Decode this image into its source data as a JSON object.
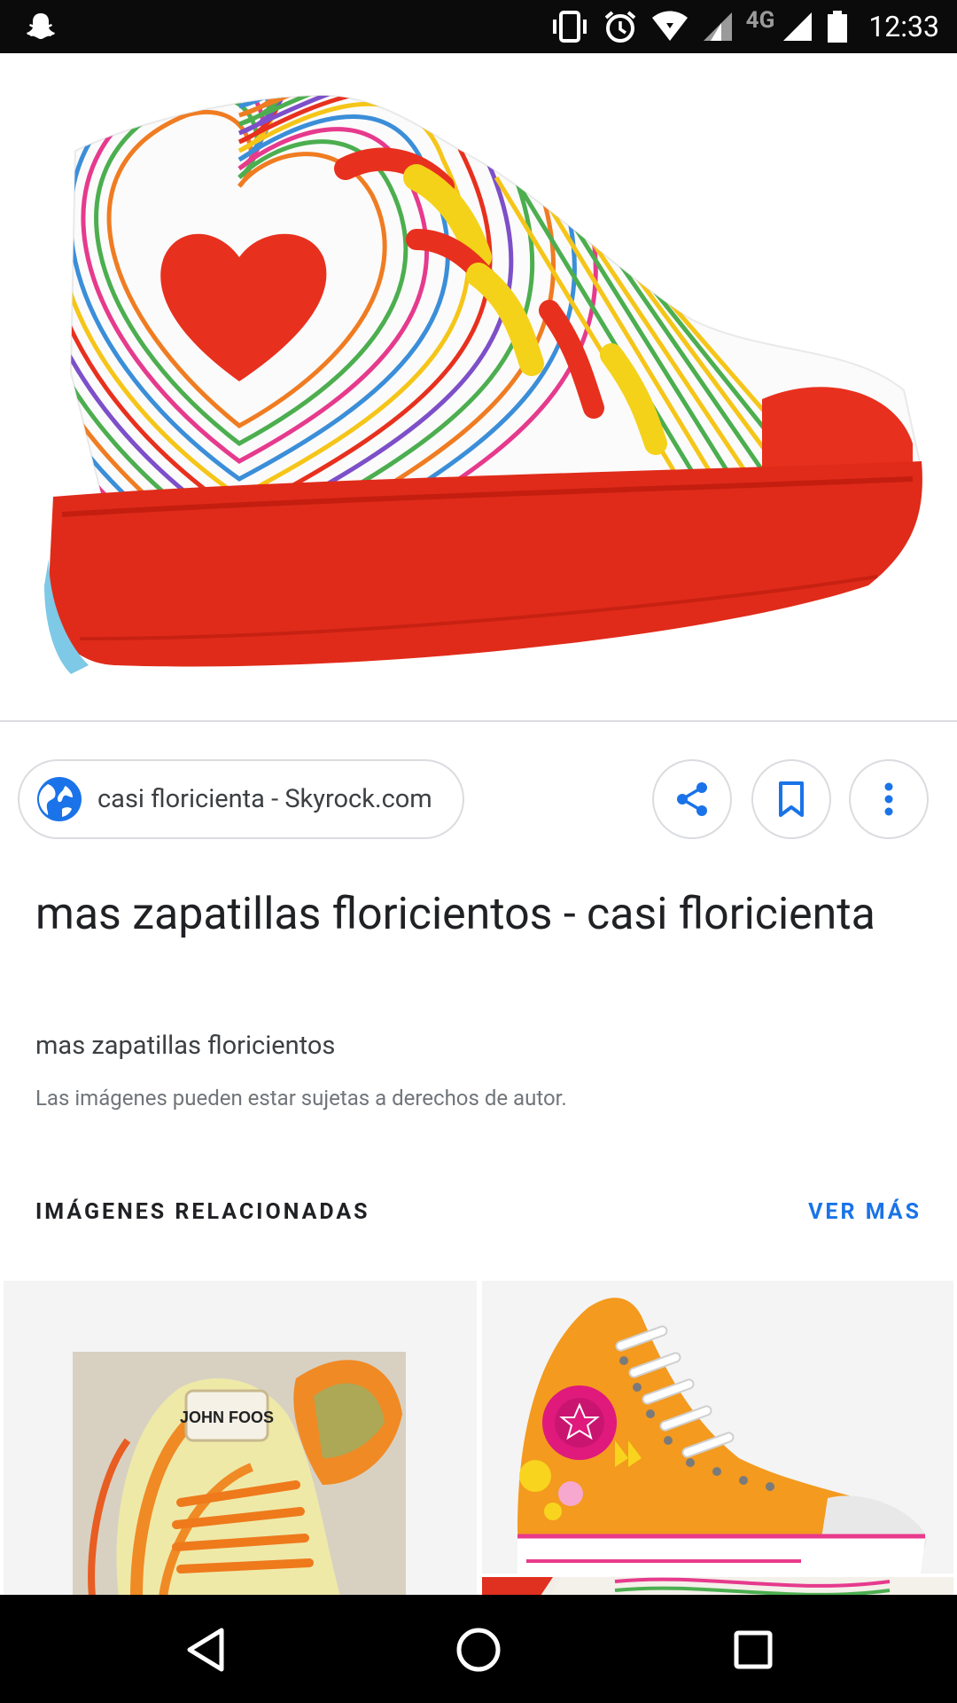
{
  "status_bar": {
    "network_label": "4G",
    "time": "12:33",
    "icons": [
      "snapchat-icon",
      "vibrate-icon",
      "alarm-icon",
      "wifi-icon",
      "cell-signal-icon",
      "battery-icon"
    ]
  },
  "hero": {
    "image": "rainbow-heart-hightop-sneaker"
  },
  "source": {
    "label": "casi floricienta - Skyrock.com",
    "icon": "globe-icon"
  },
  "actions": {
    "share_icon": "share-icon",
    "bookmark_icon": "bookmark-icon",
    "more_icon": "more-vert-icon"
  },
  "result": {
    "title": "mas zapatillas floricientos - casi floricienta",
    "subtitle": "mas zapatillas floricientos",
    "copyright": "Las imágenes pueden estar sujetas a derechos de autor."
  },
  "related": {
    "header": "IMÁGENES RELACIONADAS",
    "see_more": "VER MÁS",
    "brand_text": "JOHN FOOS"
  },
  "colors": {
    "accent": "#1a73e8",
    "shoe_red": "#e8301e",
    "shoe_orange": "#f39a1f",
    "shoe_pink": "#e0197d"
  },
  "nav": {
    "icons": [
      "back-icon",
      "home-icon",
      "recents-icon"
    ]
  }
}
